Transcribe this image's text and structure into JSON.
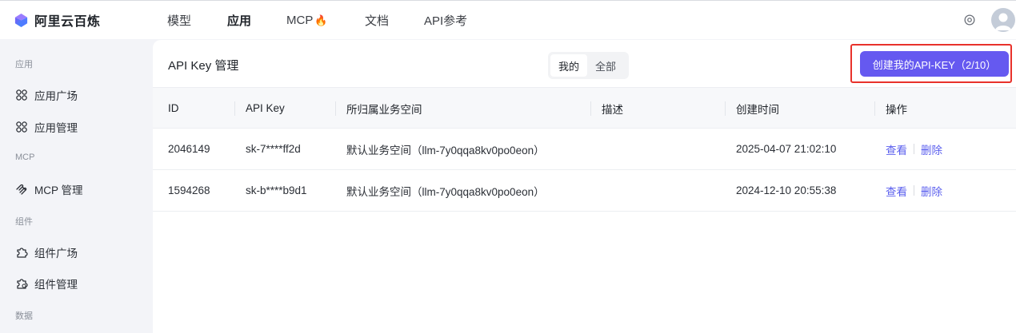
{
  "brand": {
    "name": "阿里云百炼",
    "logo_icon": "bailian-logo-icon"
  },
  "topnav": {
    "items": [
      {
        "label": "模型",
        "active": false
      },
      {
        "label": "应用",
        "active": true
      },
      {
        "label": "MCP",
        "active": false,
        "badge_icon": "fire-icon"
      },
      {
        "label": "文档",
        "active": false
      },
      {
        "label": "API参考",
        "active": false
      }
    ]
  },
  "sidebar": {
    "sections": [
      {
        "title": "应用",
        "items": [
          {
            "label": "应用广场",
            "icon": "apps-grid-icon"
          },
          {
            "label": "应用管理",
            "icon": "apps-grid-icon"
          }
        ]
      },
      {
        "title": "MCP",
        "items": [
          {
            "label": "MCP 管理",
            "icon": "mcp-icon"
          }
        ]
      },
      {
        "title": "组件",
        "items": [
          {
            "label": "组件广场",
            "icon": "puzzle-icon"
          },
          {
            "label": "组件管理",
            "icon": "puzzle-icon"
          }
        ]
      },
      {
        "title": "数据",
        "items": []
      }
    ]
  },
  "main": {
    "title": "API Key 管理",
    "filter": {
      "options": [
        "我的",
        "全部"
      ],
      "selected": "我的"
    },
    "create_button": "创建我的API-KEY（2/10）",
    "columns": [
      "ID",
      "API Key",
      "所归属业务空间",
      "描述",
      "创建时间",
      "操作"
    ],
    "rows": [
      {
        "id": "2046149",
        "key": "sk-7****ff2d",
        "workspace": "默认业务空间（llm-7y0qqa8kv0po0eon）",
        "desc": "",
        "created": "2025-04-07 21:02:10",
        "actions": [
          "查看",
          "删除"
        ]
      },
      {
        "id": "1594268",
        "key": "sk-b****b9d1",
        "workspace": "默认业务空间（llm-7y0qqa8kv0po0eon）",
        "desc": "",
        "created": "2024-12-10 20:55:38",
        "actions": [
          "查看",
          "删除"
        ]
      }
    ]
  },
  "colors": {
    "accent": "#6559f0",
    "link": "#5b5fee",
    "highlight": "#e8322b"
  }
}
